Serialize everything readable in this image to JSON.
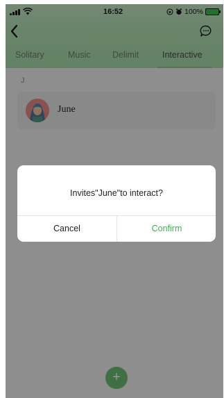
{
  "status_bar": {
    "time": "16:52",
    "battery_text": "100%"
  },
  "header": {
    "back_icon": "chevron-left-icon",
    "action_icon": "chat-bubble-icon",
    "tabs": [
      {
        "label": "Solitary",
        "active": false
      },
      {
        "label": "Music",
        "active": false
      },
      {
        "label": "Delimit",
        "active": false
      },
      {
        "label": "Interactive",
        "active": true
      }
    ]
  },
  "contacts": {
    "section_letter": "J",
    "items": [
      {
        "name": "June",
        "avatar": "cartoon-girl-avatar"
      }
    ]
  },
  "fab": {
    "label": "+",
    "icon": "plus-icon"
  },
  "dialog": {
    "message": "Invites\"June\"to interact?",
    "cancel_label": "Cancel",
    "confirm_label": "Confirm"
  },
  "colors": {
    "header_green": "#b4e3b6",
    "accent_green": "#4aa85a",
    "fab_green": "#6cc276"
  }
}
